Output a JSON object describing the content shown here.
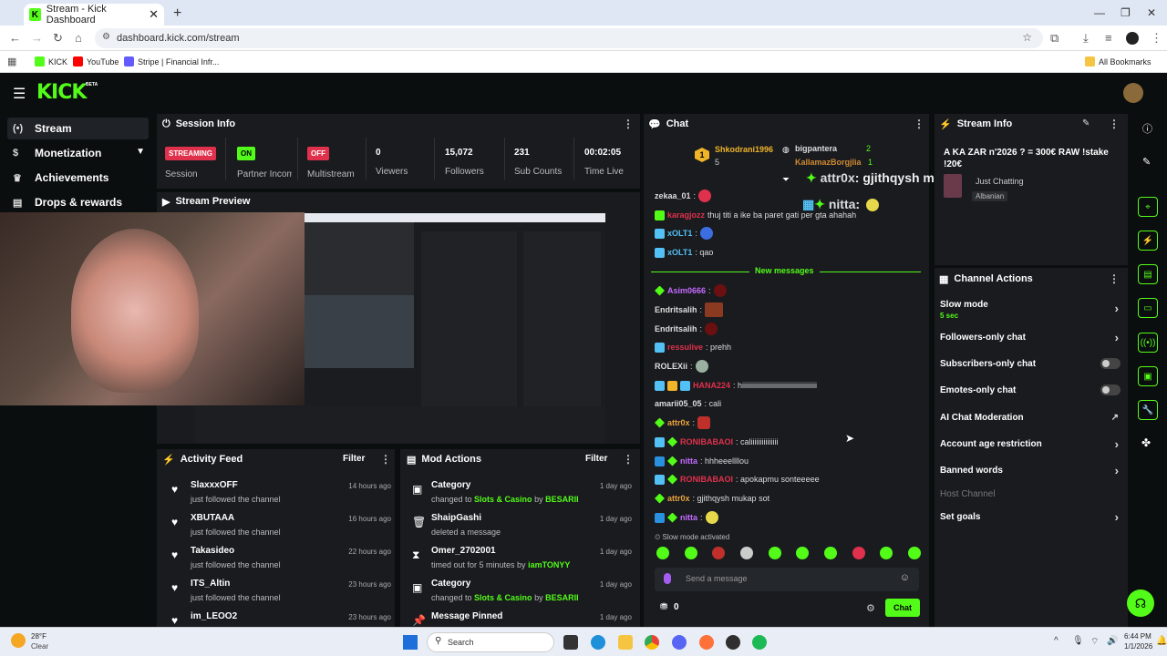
{
  "browser": {
    "tab_title": "Stream - Kick Dashboard",
    "favicon": "K",
    "url": "dashboard.kick.com/stream",
    "bookmarks": [
      "KICK",
      "YouTube",
      "Stripe | Financial Infr..."
    ],
    "all_bookmarks": "All Bookmarks"
  },
  "header": {
    "logo": "KICK",
    "logo_badge": "BETA"
  },
  "sidebar": {
    "items": [
      {
        "label": "Stream",
        "icon": "broadcast-icon"
      },
      {
        "label": "Monetization",
        "icon": "dollar-icon"
      },
      {
        "label": "Achievements",
        "icon": "trophy-icon"
      },
      {
        "label": "Drops & rewards",
        "icon": "gift-icon"
      }
    ]
  },
  "session": {
    "title": "Session Info",
    "streaming_badge": "STREAMING",
    "session_label": "Session",
    "partner_badge": "ON",
    "partner_label": "Partner Income",
    "multistream_badge": "OFF",
    "multistream_label": "Multistream",
    "viewers_value": "0",
    "viewers_label": "Viewers",
    "followers_value": "15,072",
    "followers_label": "Followers",
    "subs_value": "231",
    "subs_label": "Sub Counts",
    "time_value": "00:02:05",
    "time_label": "Time Live"
  },
  "preview": {
    "title": "Stream Preview"
  },
  "activity": {
    "title": "Activity Feed",
    "filter": "Filter",
    "rows": [
      {
        "name": "SlaxxxOFF",
        "sub": "just followed the channel",
        "ago": "14 hours ago"
      },
      {
        "name": "XBUTAAA",
        "sub": "just followed the channel",
        "ago": "16 hours ago"
      },
      {
        "name": "Takasideo",
        "sub": "just followed the channel",
        "ago": "22 hours ago"
      },
      {
        "name": "ITS_Altin",
        "sub": "just followed the channel",
        "ago": "23 hours ago"
      },
      {
        "name": "im_LEOO2",
        "sub": "",
        "ago": "23 hours ago"
      }
    ]
  },
  "mod": {
    "title": "Mod Actions",
    "filter": "Filter",
    "rows": [
      {
        "title": "Category",
        "pre": "changed to ",
        "hl": "Slots & Casino",
        "mid": " by ",
        "by": "BESARII",
        "ago": "1 day ago"
      },
      {
        "title": "ShaipGashi",
        "pre": "deleted a message",
        "hl": "",
        "mid": "",
        "by": "",
        "ago": "1 day ago"
      },
      {
        "title": "Omer_2702001",
        "pre": "timed out for 5 minutes by ",
        "hl": "",
        "mid": "",
        "by": "iamTONYY",
        "ago": "1 day ago"
      },
      {
        "title": "Category",
        "pre": "changed to ",
        "hl": "Slots & Casino",
        "mid": " by ",
        "by": "BESARII",
        "ago": "1 day ago"
      },
      {
        "title": "Message Pinned",
        "pre": "",
        "hl": "",
        "mid": "",
        "by": "",
        "ago": "1 day ago"
      }
    ]
  },
  "chat": {
    "title": "Chat",
    "leaderboard": [
      {
        "name": "Shkodrani1996",
        "count": "5"
      },
      {
        "name": "bigpantera",
        "count": "2"
      },
      {
        "name": "KallamazBorgjlia",
        "count": "1"
      }
    ],
    "overlay_1_user": "attr0x",
    "overlay_1_msg": ": gjithqysh mukap sot",
    "overlay_2_user": "nitta",
    "overlay_2_msg": ":",
    "new_messages": "New messages",
    "messages": [
      {
        "user": "zekaa_01",
        "color": "#dddddd",
        "msg": ""
      },
      {
        "user": "karagjozz",
        "color": "#e0314c",
        "msg": "thuj titi a ike ba paret gati per gta ahahah"
      },
      {
        "user": "xOLT1",
        "color": "#53c1f5",
        "msg": ""
      },
      {
        "user": "xOLT1",
        "color": "#53c1f5",
        "msg": "qao"
      },
      {
        "user": "Asim0666",
        "color": "#c56bff",
        "msg": ""
      },
      {
        "user": "Endritsalih",
        "color": "#dddddd",
        "msg": ""
      },
      {
        "user": "Endritsalih",
        "color": "#dddddd",
        "msg": ""
      },
      {
        "user": "ressulive",
        "color": "#e0314c",
        "msg": "prehh"
      },
      {
        "user": "ROLEXii",
        "color": "#dddddd",
        "msg": ""
      },
      {
        "user": "HANA224",
        "color": "#e0314c",
        "msg": "hiiiiiiiiiiiiiiiiiiiiiiiiiiiiiiiiiiiiiiiii"
      },
      {
        "user": "amarii05_05",
        "color": "#dddddd",
        "msg": "cali"
      },
      {
        "user": "attr0x",
        "color": "#e8a33a",
        "msg": ""
      },
      {
        "user": "RONIBABAOI",
        "color": "#e0314c",
        "msg": "caliiiiiiiiiiiiiii"
      },
      {
        "user": "nitta",
        "color": "#c56bff",
        "msg": "hhheeellllou"
      },
      {
        "user": "RONIBABAOI",
        "color": "#e0314c",
        "msg": "apokapmu sonteeeee"
      },
      {
        "user": "attr0x",
        "color": "#e8a33a",
        "msg": "gjithqysh mukap sot"
      },
      {
        "user": "nitta",
        "color": "#c56bff",
        "msg": ""
      }
    ],
    "slow_mode_notice": "Slow mode activated",
    "input_placeholder": "Send a message",
    "points": "0",
    "send_button": "Chat"
  },
  "stream_info": {
    "title": "Stream Info",
    "stream_title": "A KA ZAR n'2026 ? = 300€ RAW !stake !20€",
    "category": "Just Chatting",
    "language": "Albanian"
  },
  "channel_actions": {
    "title": "Channel Actions",
    "slow_mode": "Slow mode",
    "slow_mode_value": "5 sec",
    "followers_only": "Followers-only chat",
    "subscribers_only": "Subscribers-only chat",
    "emotes_only": "Emotes-only chat",
    "ai_moderation": "AI Chat Moderation",
    "account_age": "Account age restriction",
    "banned_words": "Banned words",
    "host_channel": "Host Channel",
    "set_goals": "Set goals"
  },
  "taskbar": {
    "weather_temp": "28°F",
    "weather_desc": "Clear",
    "search": "Search",
    "time": "6:44 PM",
    "date": "1/1/2026"
  },
  "colors": {
    "accent": "#53fc18",
    "live_red": "#e0314c",
    "panel_bg": "#191b1f",
    "app_bg": "#0b0e0f"
  }
}
